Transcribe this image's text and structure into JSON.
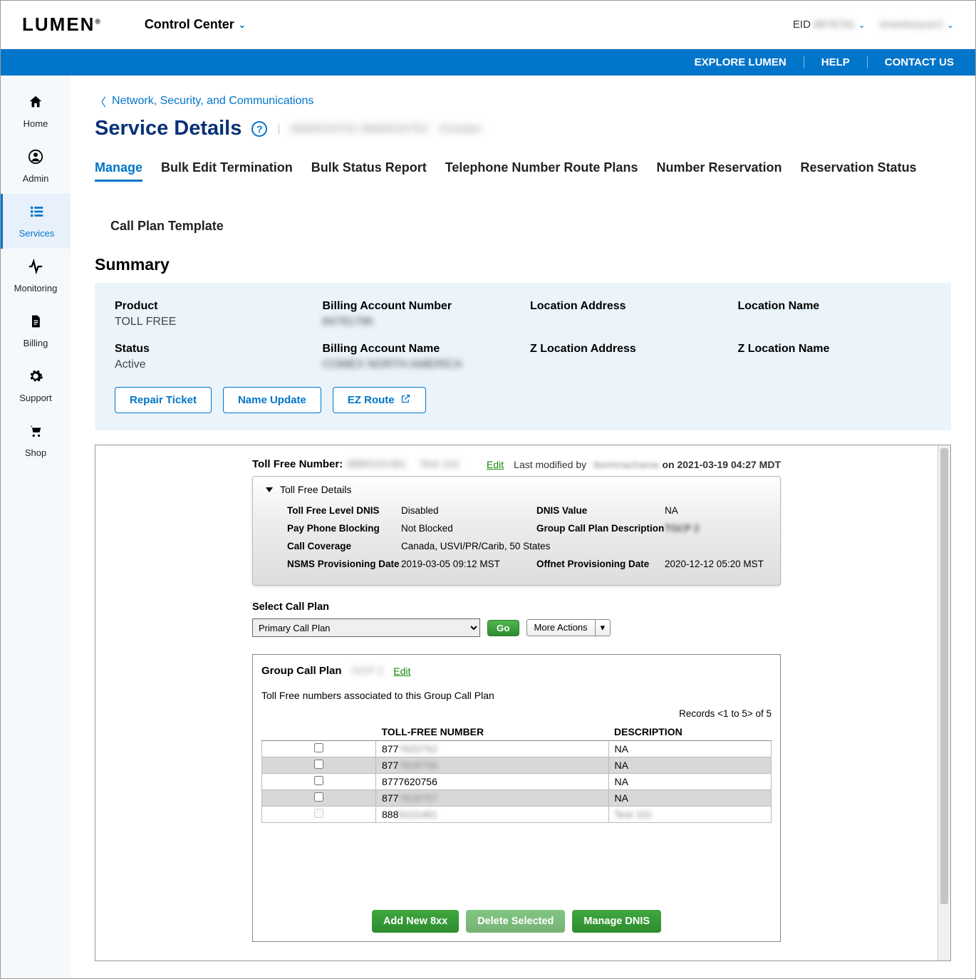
{
  "brand": "LUMEN",
  "control_center": "Control Center",
  "eid_label": "EID",
  "eid_value": "8878781",
  "user_value": "inventoryusr1",
  "bluebar": {
    "explore": "EXPLORE LUMEN",
    "help": "HELP",
    "contact": "CONTACT US"
  },
  "sidebar": [
    {
      "icon": "⌂",
      "label": "Home"
    },
    {
      "icon": "●",
      "label": "Admin"
    },
    {
      "icon": "☰",
      "label": "Services"
    },
    {
      "icon": "∿",
      "label": "Monitoring"
    },
    {
      "icon": "▤",
      "label": "Billing"
    },
    {
      "icon": "⚙",
      "label": "Support"
    },
    {
      "icon": "▼",
      "label": "Shop"
    }
  ],
  "breadcrumb": "Network, Security, and Communications",
  "page_title": "Service Details",
  "title_meta": "8889526762   8889526762 · October",
  "tabs": [
    "Manage",
    "Bulk Edit Termination",
    "Bulk Status Report",
    "Telephone Number Route Plans",
    "Number Reservation",
    "Reservation Status"
  ],
  "tab_sub": "Call Plan Template",
  "summary_heading": "Summary",
  "summary": {
    "product_l": "Product",
    "product_v": "TOLL FREE",
    "ban_l": "Billing Account Number",
    "ban_v": "84781796",
    "loc_l": "Location Address",
    "loc_v": "",
    "locname_l": "Location Name",
    "locname_v": "",
    "status_l": "Status",
    "status_v": "Active",
    "baname_l": "Billing Account Name",
    "baname_v": "COMEX NORTH AMERICA",
    "zloc_l": "Z Location Address",
    "zloc_v": "",
    "zlocname_l": "Z Location Name",
    "zlocname_v": ""
  },
  "sum_btns": {
    "repair": "Repair Ticket",
    "name": "Name Update",
    "ez": "EZ Route"
  },
  "tf": {
    "label": "Toll Free Number:",
    "num": "8889101481",
    "plan": "Test 101",
    "edit": "Edit",
    "modified_prefix": "Last modified by ",
    "modified_user": "tkemmacharne",
    "modified_suffix": " on 2021-03-19 04:27 MDT",
    "details_title": "Toll Free Details",
    "rows": {
      "dnis_l": "Toll Free Level DNIS",
      "dnis_v": "Disabled",
      "dnisval_l": "DNIS Value",
      "dnisval_v": "NA",
      "pay_l": "Pay Phone Blocking",
      "pay_v": "Not Blocked",
      "gcp_l": "Group Call Plan Description",
      "gcp_v": "TGCP 2",
      "cov_l": "Call Coverage",
      "cov_v": "Canada, USVI/PR/Carib, 50 States",
      "nsms_l": "NSMS Provisioning Date",
      "nsms_v": "2019-03-05 09:12 MST",
      "off_l": "Offnet Provisioning Date",
      "off_v": "2020-12-12 05:20 MST"
    }
  },
  "select_cp": {
    "label": "Select Call Plan",
    "option": "Primary Call Plan",
    "go": "Go",
    "more": "More Actions"
  },
  "group": {
    "title": "Group Call Plan",
    "id": "GCP 2",
    "edit": "Edit",
    "assoc": "Toll Free numbers associated to this Group Call Plan",
    "records": "Records <1 to 5> of 5",
    "th_num": "TOLL-FREE NUMBER",
    "th_desc": "DESCRIPTION",
    "rows": [
      {
        "num": "877",
        "rest": "7620752",
        "desc": "NA"
      },
      {
        "num": "877",
        "rest": "7628756",
        "desc": "NA"
      },
      {
        "num": "877",
        "rest": "7620756",
        "desc": "NA"
      },
      {
        "num": "877",
        "rest": "7628757",
        "desc": "NA"
      },
      {
        "num": "888",
        "rest": "9101481",
        "desc": "Test 101"
      }
    ],
    "btns": {
      "add": "Add New 8xx",
      "del": "Delete Selected",
      "dnis": "Manage DNIS"
    }
  }
}
